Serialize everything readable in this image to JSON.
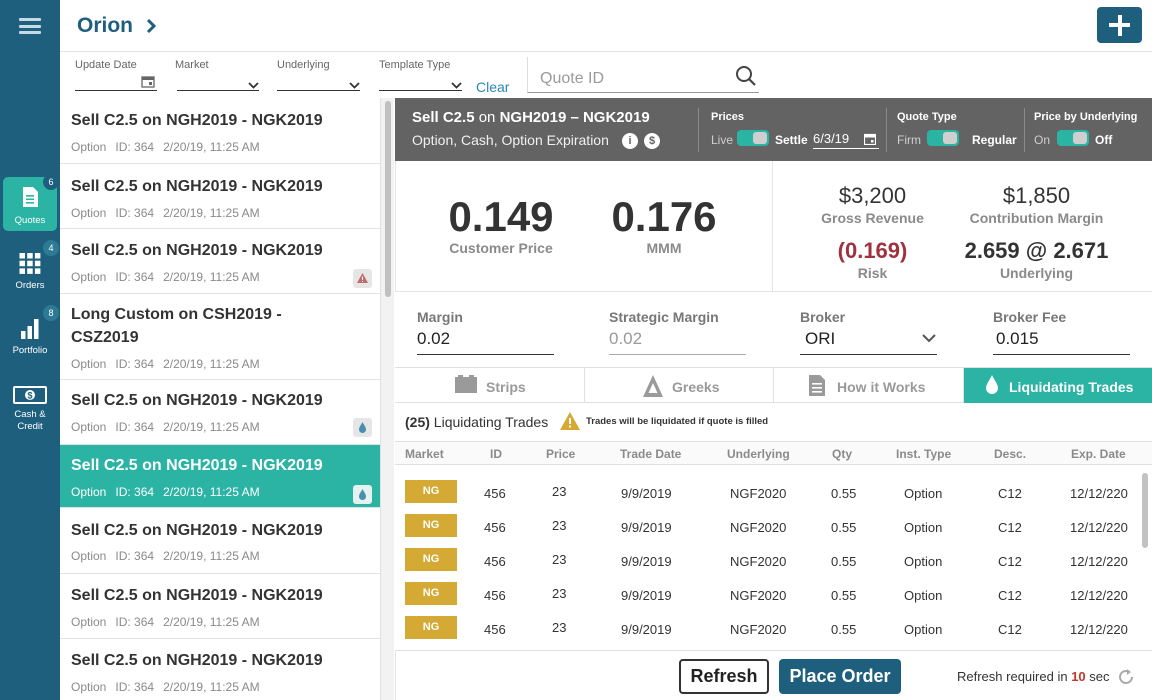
{
  "header": {
    "title": "Orion"
  },
  "nav": {
    "items": [
      {
        "label": "Quotes",
        "badge": "6"
      },
      {
        "label": "Orders",
        "badge": "4"
      },
      {
        "label": "Portfolio",
        "badge": "8"
      },
      {
        "label": "Cash &",
        "label2": "Credit"
      }
    ]
  },
  "filters": {
    "update_date": "Update Date",
    "market": "Market",
    "underlying": "Underlying",
    "template_type": "Template Type",
    "clear": "Clear",
    "quote_id_placeholder": "Quote ID"
  },
  "list": [
    {
      "title": "Sell C2.5 on NGH2019 - NGK2019",
      "type": "Option",
      "id": "ID: 364",
      "date": "2/20/19, 11:25 AM"
    },
    {
      "title": "Sell C2.5 on NGH2019 - NGK2019",
      "type": "Option",
      "id": "ID: 364",
      "date": "2/20/19, 11:25 AM"
    },
    {
      "title": "Sell C2.5 on NGH2019 - NGK2019",
      "type": "Option",
      "id": "ID: 364",
      "date": "2/20/19, 11:25 AM",
      "icon": "warning-icon"
    },
    {
      "title": "Long Custom on CSH2019 -",
      "title2": "CSZ2019",
      "type": "Option",
      "id": "ID: 364",
      "date": "2/20/19, 11:25 AM"
    },
    {
      "title": "Sell C2.5 on NGH2019 - NGK2019",
      "type": "Option",
      "id": "ID: 364",
      "date": "2/20/19, 11:25 AM",
      "icon": "drop-icon"
    },
    {
      "title": "Sell C2.5 on NGH2019 - NGK2019",
      "type": "Option",
      "id": "ID: 364",
      "date": "2/20/19, 11:25 AM",
      "icon": "drop-icon",
      "selected": true
    },
    {
      "title": "Sell C2.5 on NGH2019 - NGK2019",
      "type": "Option",
      "id": "ID: 364",
      "date": "2/20/19, 11:25 AM"
    },
    {
      "title": "Sell C2.5 on NGH2019 - NGK2019",
      "type": "Option",
      "id": "ID: 364",
      "date": "2/20/19, 11:25 AM"
    },
    {
      "title": "Sell C2.5 on NGH2019 - NGK2019",
      "type": "Option",
      "id": "ID: 364",
      "date": "2/20/19, 11:25 AM"
    }
  ],
  "quote": {
    "title_prefix": "Sell C2.5",
    "title_on": "on",
    "title_suffix": "NGH2019 – NGK2019",
    "subtitle": "Option, Cash, Option Expiration",
    "prices_label": "Prices",
    "live": "Live",
    "settle": "Settle",
    "settle_date": "6/3/19",
    "quote_type_label": "Quote Type",
    "firm": "Firm",
    "regular": "Regular",
    "price_by_underlying_label": "Price by Underlying",
    "on": "On",
    "off": "Off"
  },
  "prices": {
    "customer_price": "0.149",
    "customer_price_label": "Customer Price",
    "mmm": "0.176",
    "mmm_label": "MMM",
    "gross_revenue": "$3,200",
    "gross_revenue_label": "Gross Revenue",
    "contribution_margin": "$1,850",
    "contribution_margin_label": "Contribution Margin",
    "risk": "(0.169)",
    "risk_label": "Risk",
    "underlying": "2.659 @ 2.671",
    "underlying_label": "Underlying"
  },
  "inputs": {
    "margin_label": "Margin",
    "margin": "0.02",
    "strategic_margin_label": "Strategic Margin",
    "strategic_margin": "0.02",
    "broker_label": "Broker",
    "broker": "ORI",
    "broker_fee_label": "Broker Fee",
    "broker_fee": "0.015"
  },
  "tabs": [
    "Strips",
    "Greeks",
    "How it Works",
    "Liquidating Trades"
  ],
  "trades": {
    "count": "(25)",
    "title": "Liquidating Trades",
    "warning": "Trades will be liquidated if quote is filled",
    "columns": [
      "Market",
      "ID",
      "Price",
      "Trade Date",
      "Underlying",
      "Qty",
      "Inst. Type",
      "Desc.",
      "Exp. Date"
    ],
    "rows": [
      [
        "NG",
        "456",
        "23",
        "9/9/2019",
        "NGF2020",
        "0.55",
        "Option",
        "C12",
        "12/12/220"
      ],
      [
        "NG",
        "456",
        "23",
        "9/9/2019",
        "NGF2020",
        "0.55",
        "Option",
        "C12",
        "12/12/220"
      ],
      [
        "NG",
        "456",
        "23",
        "9/9/2019",
        "NGF2020",
        "0.55",
        "Option",
        "C12",
        "12/12/220"
      ],
      [
        "NG",
        "456",
        "23",
        "9/9/2019",
        "NGF2020",
        "0.55",
        "Option",
        "C12",
        "12/12/220"
      ],
      [
        "NG",
        "456",
        "23",
        "9/9/2019",
        "NGF2020",
        "0.55",
        "Option",
        "C12",
        "12/12/220"
      ]
    ]
  },
  "footer": {
    "refresh": "Refresh",
    "place_order": "Place Order",
    "refresh_note_prefix": "Refresh required in",
    "seconds": "10",
    "sec": "sec"
  }
}
